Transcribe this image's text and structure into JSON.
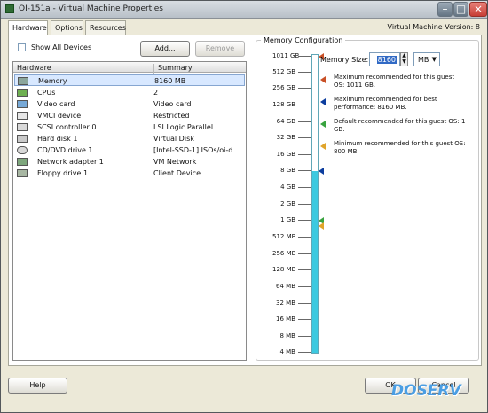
{
  "window": {
    "title": "OI-151a - Virtual Machine Properties",
    "controls": {
      "minimize": "–",
      "maximize": "□",
      "close": "×"
    }
  },
  "tabs": [
    {
      "label": "Hardware"
    },
    {
      "label": "Options"
    },
    {
      "label": "Resources"
    }
  ],
  "header": {
    "version": "Virtual Machine Version: 8"
  },
  "hardware_panel": {
    "show_all_devices": "Show All Devices",
    "add_button": "Add...",
    "remove_button": "Remove",
    "columns": {
      "hardware": "Hardware",
      "summary": "Summary"
    },
    "items": [
      {
        "name": "Memory",
        "summary": "8160 MB",
        "icon": "memory-icon",
        "selected": true
      },
      {
        "name": "CPUs",
        "summary": "2",
        "icon": "cpu-icon"
      },
      {
        "name": "Video card",
        "summary": "Video card",
        "icon": "display-icon"
      },
      {
        "name": "VMCI device",
        "summary": "Restricted",
        "icon": "vmci-icon"
      },
      {
        "name": "SCSI controller 0",
        "summary": "LSI Logic Parallel",
        "icon": "scsi-icon"
      },
      {
        "name": "Hard disk 1",
        "summary": "Virtual Disk",
        "icon": "disk-icon"
      },
      {
        "name": "CD/DVD drive 1",
        "summary": "[Intel-SSD-1] ISOs/oi-d...",
        "icon": "cd-icon"
      },
      {
        "name": "Network adapter 1",
        "summary": "VM Network",
        "icon": "network-icon"
      },
      {
        "name": "Floppy drive 1",
        "summary": "Client Device",
        "icon": "floppy-icon"
      }
    ]
  },
  "memory": {
    "group_title": "Memory Configuration",
    "size_label": "Memory Size:",
    "size_value": "8160",
    "unit": "MB",
    "scale_labels": [
      "1011 GB",
      "512 GB",
      "256 GB",
      "128 GB",
      "64 GB",
      "32 GB",
      "16 GB",
      "8 GB",
      "4 GB",
      "2 GB",
      "1 GB",
      "512 MB",
      "256 MB",
      "128 MB",
      "64 MB",
      "32 MB",
      "16 MB",
      "8 MB",
      "4 MB"
    ],
    "legend": [
      {
        "text": "Maximum recommended for this guest OS: 1011 GB.",
        "color": "#c95026",
        "icon": "orange-marker-icon"
      },
      {
        "text": "Maximum recommended for best performance: 8160 MB.",
        "color": "#0c3d9e",
        "icon": "blue-marker-icon"
      },
      {
        "text": "Default recommended for this guest OS: 1 GB.",
        "color": "#38a33f",
        "icon": "green-marker-icon"
      },
      {
        "text": "Minimum recommended for this guest OS: 800 MB.",
        "color": "#e0a42a",
        "icon": "gold-marker-icon"
      }
    ]
  },
  "footer": {
    "help": "Help",
    "ok": "OK",
    "cancel": "Cancel"
  },
  "watermark": "DOSERV"
}
